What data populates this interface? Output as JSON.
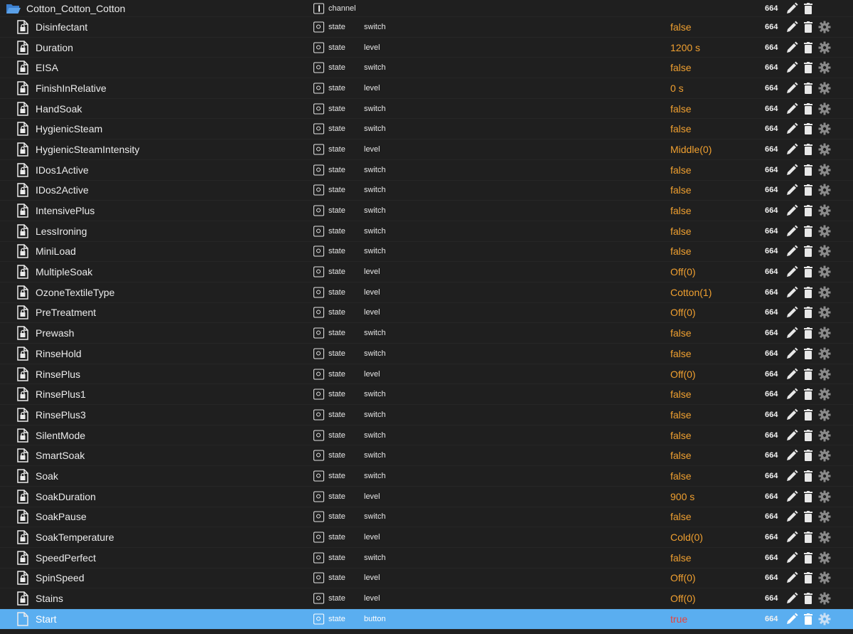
{
  "folder": {
    "name": "Cotton_Cotton_Cotton",
    "type": "channel",
    "acl": "664",
    "icons": [
      "folder-open-icon",
      "channel-icon",
      "edit-icon",
      "delete-icon"
    ]
  },
  "rows": [
    {
      "name": "Disinfectant",
      "type": "state",
      "role": "switch",
      "value": "false",
      "acl": "664"
    },
    {
      "name": "Duration",
      "type": "state",
      "role": "level",
      "value": "1200 s",
      "acl": "664"
    },
    {
      "name": "EISA",
      "type": "state",
      "role": "switch",
      "value": "false",
      "acl": "664"
    },
    {
      "name": "FinishInRelative",
      "type": "state",
      "role": "level",
      "value": "0 s",
      "acl": "664"
    },
    {
      "name": "HandSoak",
      "type": "state",
      "role": "switch",
      "value": "false",
      "acl": "664"
    },
    {
      "name": "HygienicSteam",
      "type": "state",
      "role": "switch",
      "value": "false",
      "acl": "664"
    },
    {
      "name": "HygienicSteamIntensity",
      "type": "state",
      "role": "level",
      "value": "Middle(0)",
      "acl": "664"
    },
    {
      "name": "IDos1Active",
      "type": "state",
      "role": "switch",
      "value": "false",
      "acl": "664"
    },
    {
      "name": "IDos2Active",
      "type": "state",
      "role": "switch",
      "value": "false",
      "acl": "664"
    },
    {
      "name": "IntensivePlus",
      "type": "state",
      "role": "switch",
      "value": "false",
      "acl": "664"
    },
    {
      "name": "LessIroning",
      "type": "state",
      "role": "switch",
      "value": "false",
      "acl": "664"
    },
    {
      "name": "MiniLoad",
      "type": "state",
      "role": "switch",
      "value": "false",
      "acl": "664"
    },
    {
      "name": "MultipleSoak",
      "type": "state",
      "role": "level",
      "value": "Off(0)",
      "acl": "664"
    },
    {
      "name": "OzoneTextileType",
      "type": "state",
      "role": "level",
      "value": "Cotton(1)",
      "acl": "664"
    },
    {
      "name": "PreTreatment",
      "type": "state",
      "role": "level",
      "value": "Off(0)",
      "acl": "664"
    },
    {
      "name": "Prewash",
      "type": "state",
      "role": "switch",
      "value": "false",
      "acl": "664"
    },
    {
      "name": "RinseHold",
      "type": "state",
      "role": "switch",
      "value": "false",
      "acl": "664"
    },
    {
      "name": "RinsePlus",
      "type": "state",
      "role": "level",
      "value": "Off(0)",
      "acl": "664"
    },
    {
      "name": "RinsePlus1",
      "type": "state",
      "role": "switch",
      "value": "false",
      "acl": "664"
    },
    {
      "name": "RinsePlus3",
      "type": "state",
      "role": "switch",
      "value": "false",
      "acl": "664"
    },
    {
      "name": "SilentMode",
      "type": "state",
      "role": "switch",
      "value": "false",
      "acl": "664"
    },
    {
      "name": "SmartSoak",
      "type": "state",
      "role": "switch",
      "value": "false",
      "acl": "664"
    },
    {
      "name": "Soak",
      "type": "state",
      "role": "switch",
      "value": "false",
      "acl": "664"
    },
    {
      "name": "SoakDuration",
      "type": "state",
      "role": "level",
      "value": "900 s",
      "acl": "664"
    },
    {
      "name": "SoakPause",
      "type": "state",
      "role": "switch",
      "value": "false",
      "acl": "664"
    },
    {
      "name": "SoakTemperature",
      "type": "state",
      "role": "level",
      "value": "Cold(0)",
      "acl": "664"
    },
    {
      "name": "SpeedPerfect",
      "type": "state",
      "role": "switch",
      "value": "false",
      "acl": "664"
    },
    {
      "name": "SpinSpeed",
      "type": "state",
      "role": "level",
      "value": "Off(0)",
      "acl": "664"
    },
    {
      "name": "Stains",
      "type": "state",
      "role": "level",
      "value": "Off(0)",
      "acl": "664"
    },
    {
      "name": "Start",
      "type": "state",
      "role": "button",
      "value": "true",
      "acl": "664",
      "selected": true,
      "value_color": "red"
    }
  ],
  "colors": {
    "background": "#1f1f1f",
    "value": "#f0a030",
    "value_true": "#e8443a",
    "selected_row": "#5aaef0",
    "folder": "#4a8fd8"
  }
}
